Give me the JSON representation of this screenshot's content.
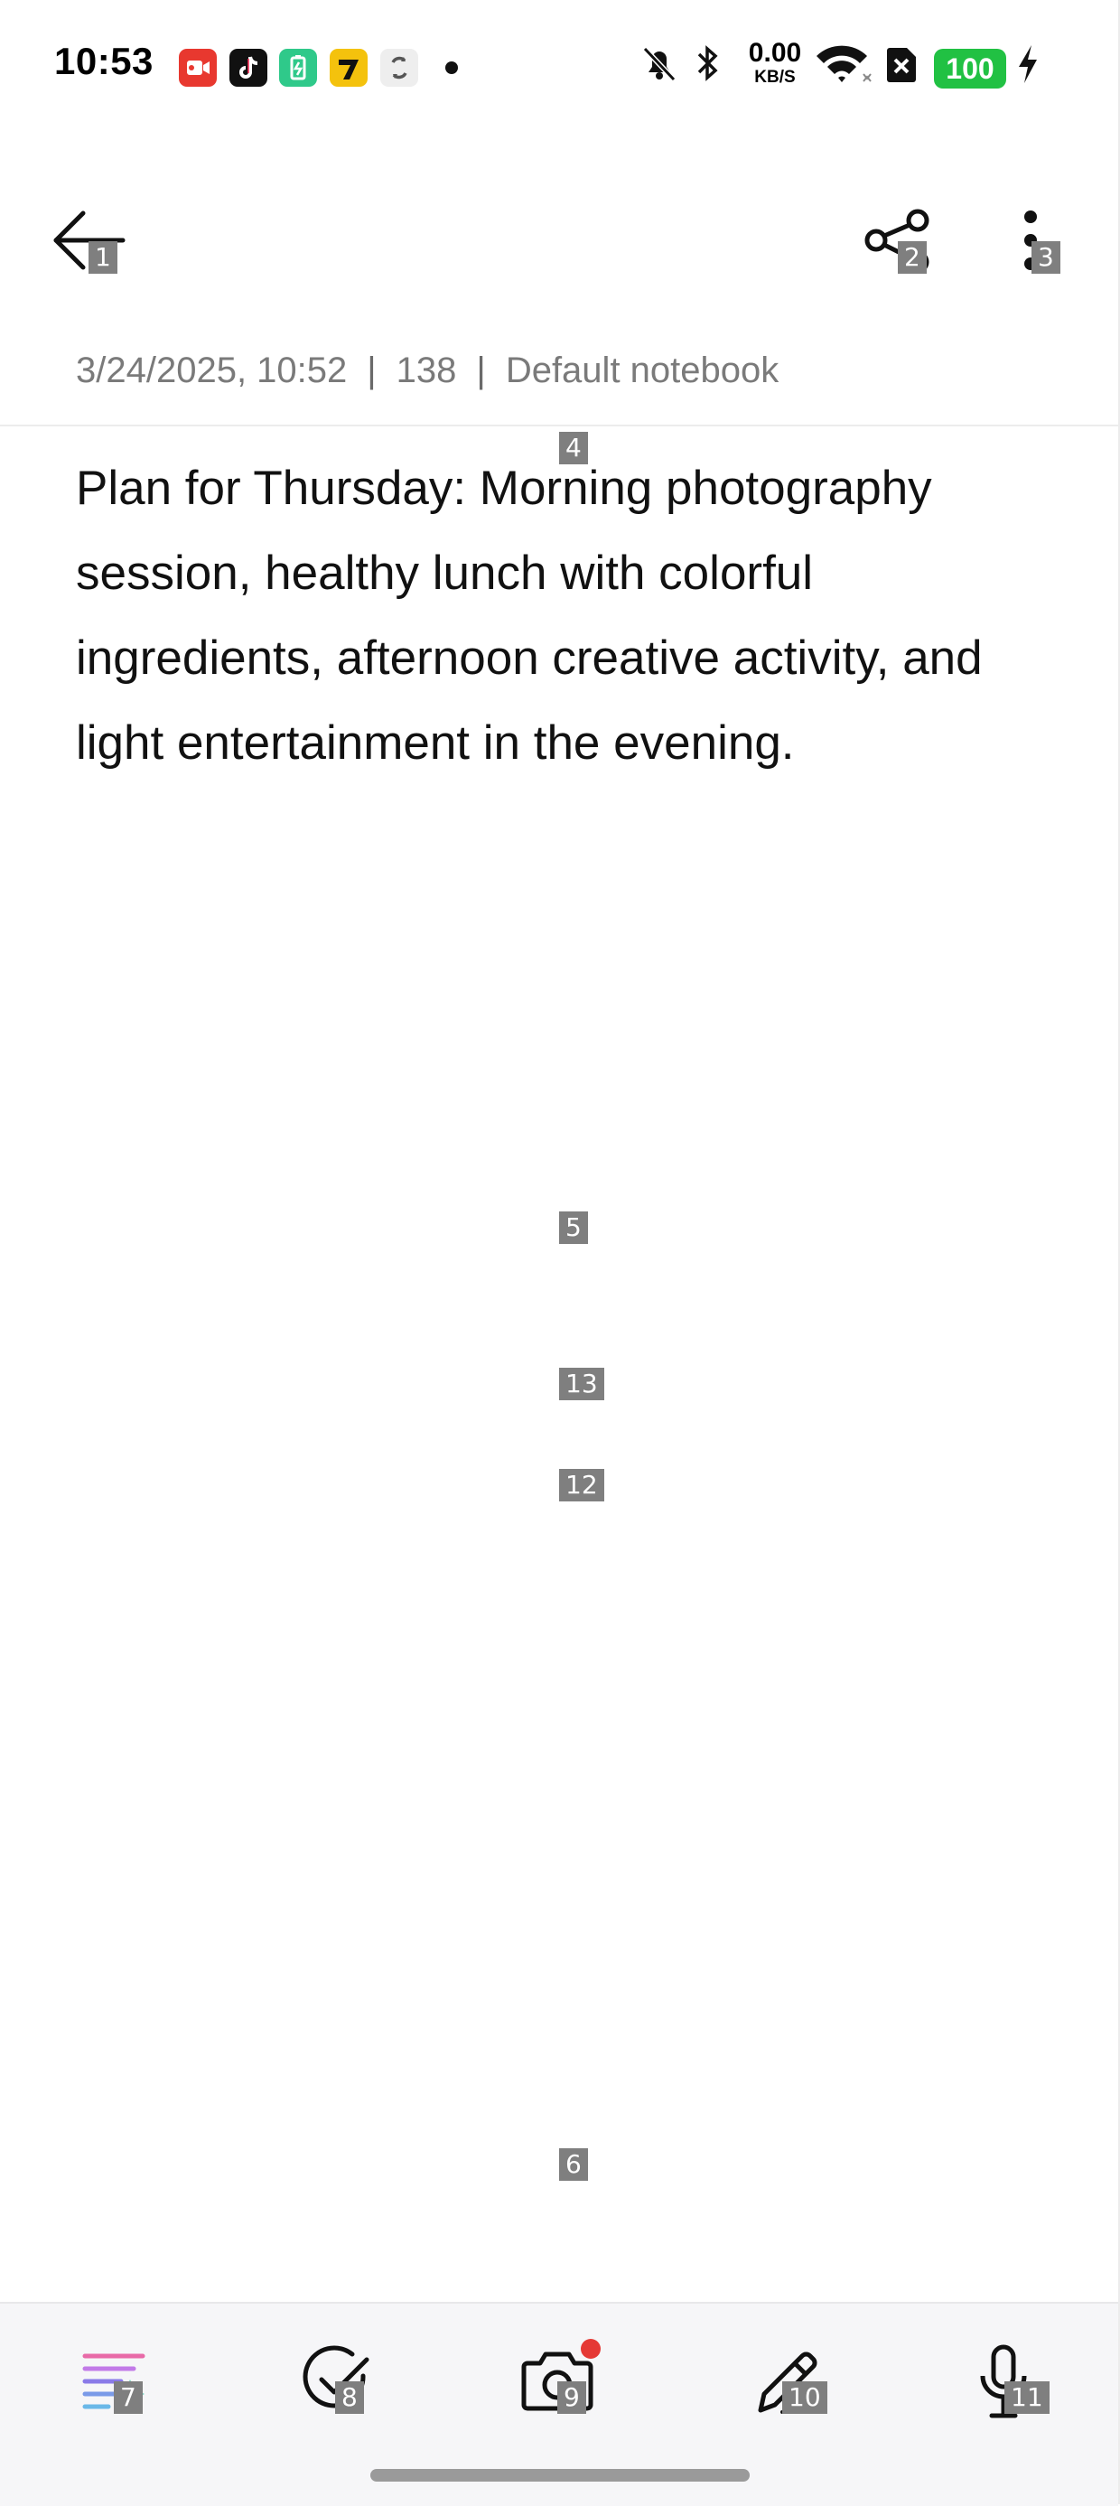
{
  "status_bar": {
    "time": "10:53",
    "network_speed": "0.00",
    "network_unit": "KB/S",
    "battery": "100",
    "icons": [
      "video-app-icon",
      "tiktok-icon",
      "battery-saver-icon",
      "game-app-icon",
      "sync-app-icon",
      "notification-dot",
      "mute-icon",
      "bluetooth-icon",
      "wifi-icon",
      "no-sim-icon",
      "battery-icon",
      "charging-icon"
    ]
  },
  "toolbar": {
    "back_icon": "back-arrow-icon",
    "share_icon": "share-icon",
    "more_icon": "more-vertical-icon"
  },
  "note": {
    "date": "3/24/2025, 10:52",
    "char_count": "138",
    "notebook": "Default notebook",
    "separator": "|",
    "content": "Plan for Thursday: Morning photography session, healthy lunch with colorful ingredients, afternoon creative activity, and light entertainment in the evening."
  },
  "bottom_bar": {
    "items": [
      "format-text-icon",
      "checklist-icon",
      "camera-icon",
      "pen-icon",
      "microphone-icon"
    ]
  },
  "badges": {
    "b1": "1",
    "b2": "2",
    "b3": "3",
    "b4": "4",
    "b5": "5",
    "b6": "6",
    "b7": "7",
    "b8": "8",
    "b9": "9",
    "b10": "10",
    "b11": "11",
    "b12": "12",
    "b13": "13"
  },
  "colors": {
    "accent_red": "#e53935",
    "battery_green": "#21c143",
    "meta_gray": "#7a7a7a",
    "badge_gray": "#7f7f7f"
  }
}
